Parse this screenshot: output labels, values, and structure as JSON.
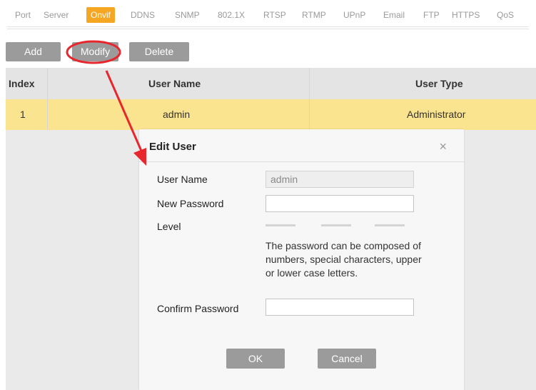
{
  "tabs": [
    {
      "label": "Port"
    },
    {
      "label": "Server"
    },
    {
      "label": "Onvif",
      "active": true
    },
    {
      "label": "DDNS"
    },
    {
      "label": "SNMP"
    },
    {
      "label": "802.1X"
    },
    {
      "label": "RTSP"
    },
    {
      "label": "RTMP"
    },
    {
      "label": "UPnP"
    },
    {
      "label": "Email"
    },
    {
      "label": "FTP"
    },
    {
      "label": "HTTPS"
    },
    {
      "label": "QoS"
    }
  ],
  "toolbar": {
    "add_label": "Add",
    "modify_label": "Modify",
    "delete_label": "Delete"
  },
  "table": {
    "headers": {
      "index": "Index",
      "user_name": "User Name",
      "user_type": "User Type"
    },
    "rows": [
      {
        "index": "1",
        "user_name": "admin",
        "user_type": "Administrator"
      }
    ]
  },
  "dialog": {
    "title": "Edit User",
    "close_glyph": "×",
    "user_name_label": "User Name",
    "user_name_value": "admin",
    "new_password_label": "New Password",
    "new_password_value": "",
    "level_label": "Level",
    "hint": "The password can be composed of numbers, special characters, upper or lower case letters.",
    "confirm_password_label": "Confirm Password",
    "confirm_password_value": "",
    "ok_label": "OK",
    "cancel_label": "Cancel"
  },
  "colors": {
    "accent": "#f5a623",
    "selected_row": "#fbe48f",
    "button_gray": "#9b9b9b",
    "annotation_red": "#e8262d"
  },
  "icons": {
    "close": "close-icon",
    "arrow": "annotation-arrow-icon"
  }
}
